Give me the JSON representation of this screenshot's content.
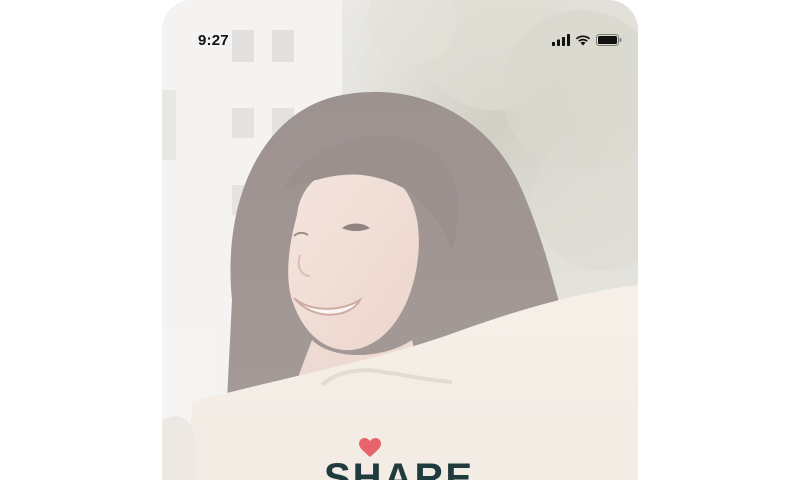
{
  "status_bar": {
    "time": "9:27",
    "icons": [
      "cellular-signal-icon",
      "wifi-icon",
      "battery-icon"
    ]
  },
  "hero": {
    "description_hidden": true
  },
  "brand": {
    "logo_text": "SHARE",
    "accent_color": "#e8646c",
    "text_color": "#1f3b3d"
  }
}
